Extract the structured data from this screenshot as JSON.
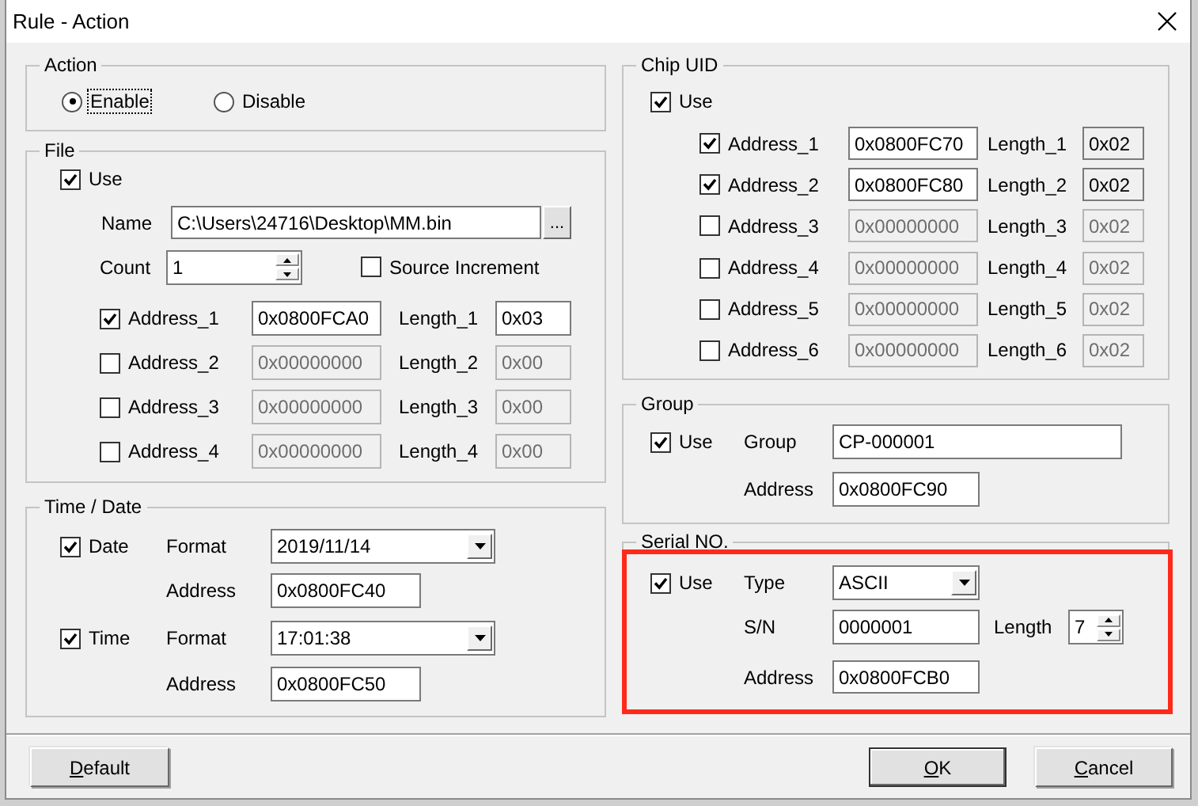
{
  "window": {
    "title": "Rule - Action"
  },
  "action": {
    "title": "Action",
    "options": [
      {
        "label": "Enable",
        "selected": true,
        "focused": true
      },
      {
        "label": "Disable",
        "selected": false,
        "focused": false
      }
    ]
  },
  "file": {
    "title": "File",
    "use": {
      "label": "Use",
      "checked": true
    },
    "name_label": "Name",
    "name": "C:\\Users\\24716\\Desktop\\MM.bin",
    "browse": "...",
    "count_label": "Count",
    "count": "1",
    "source_increment": {
      "label": "Source Increment",
      "checked": false
    },
    "length_readonly": false,
    "addresses": [
      {
        "label": "Address_1",
        "checked": true,
        "value": "0x0800FCA0",
        "length_label": "Length_1",
        "length": "0x03"
      },
      {
        "label": "Address_2",
        "checked": false,
        "value": "0x00000000",
        "length_label": "Length_2",
        "length": "0x00"
      },
      {
        "label": "Address_3",
        "checked": false,
        "value": "0x00000000",
        "length_label": "Length_3",
        "length": "0x00"
      },
      {
        "label": "Address_4",
        "checked": false,
        "value": "0x00000000",
        "length_label": "Length_4",
        "length": "0x00"
      }
    ]
  },
  "time_date": {
    "title": "Time / Date",
    "items": [
      {
        "label": "Date",
        "checked": true,
        "format_label": "Format",
        "format": "2019/11/14",
        "address_label": "Address",
        "address": "0x0800FC40"
      },
      {
        "label": "Time",
        "checked": true,
        "format_label": "Format",
        "format": "17:01:38",
        "address_label": "Address",
        "address": "0x0800FC50"
      }
    ]
  },
  "chip_uid": {
    "title": "Chip UID",
    "use": {
      "label": "Use",
      "checked": true
    },
    "length_readonly": true,
    "addresses": [
      {
        "label": "Address_1",
        "checked": true,
        "value": "0x0800FC70",
        "length_label": "Length_1",
        "length": "0x02"
      },
      {
        "label": "Address_2",
        "checked": true,
        "value": "0x0800FC80",
        "length_label": "Length_2",
        "length": "0x02"
      },
      {
        "label": "Address_3",
        "checked": false,
        "value": "0x00000000",
        "length_label": "Length_3",
        "length": "0x02"
      },
      {
        "label": "Address_4",
        "checked": false,
        "value": "0x00000000",
        "length_label": "Length_4",
        "length": "0x02"
      },
      {
        "label": "Address_5",
        "checked": false,
        "value": "0x00000000",
        "length_label": "Length_5",
        "length": "0x02"
      },
      {
        "label": "Address_6",
        "checked": false,
        "value": "0x00000000",
        "length_label": "Length_6",
        "length": "0x02"
      }
    ]
  },
  "group": {
    "title": "Group",
    "use": {
      "label": "Use",
      "checked": true
    },
    "group_label": "Group",
    "group": "CP-000001",
    "address_label": "Address",
    "address": "0x0800FC90"
  },
  "serial": {
    "title": "Serial NO.",
    "highlighted": true,
    "use": {
      "label": "Use",
      "checked": true
    },
    "type_label": "Type",
    "type": "ASCII",
    "sn_label": "S/N",
    "sn": "0000001",
    "length_label": "Length",
    "length": "7",
    "address_label": "Address",
    "address": "0x0800FCB0"
  },
  "buttons": [
    {
      "label": "Default",
      "mnemonic": true,
      "is_default": false
    },
    {
      "label": "OK",
      "mnemonic": true,
      "is_default": true
    },
    {
      "label": "Cancel",
      "mnemonic": true,
      "is_default": false
    }
  ]
}
